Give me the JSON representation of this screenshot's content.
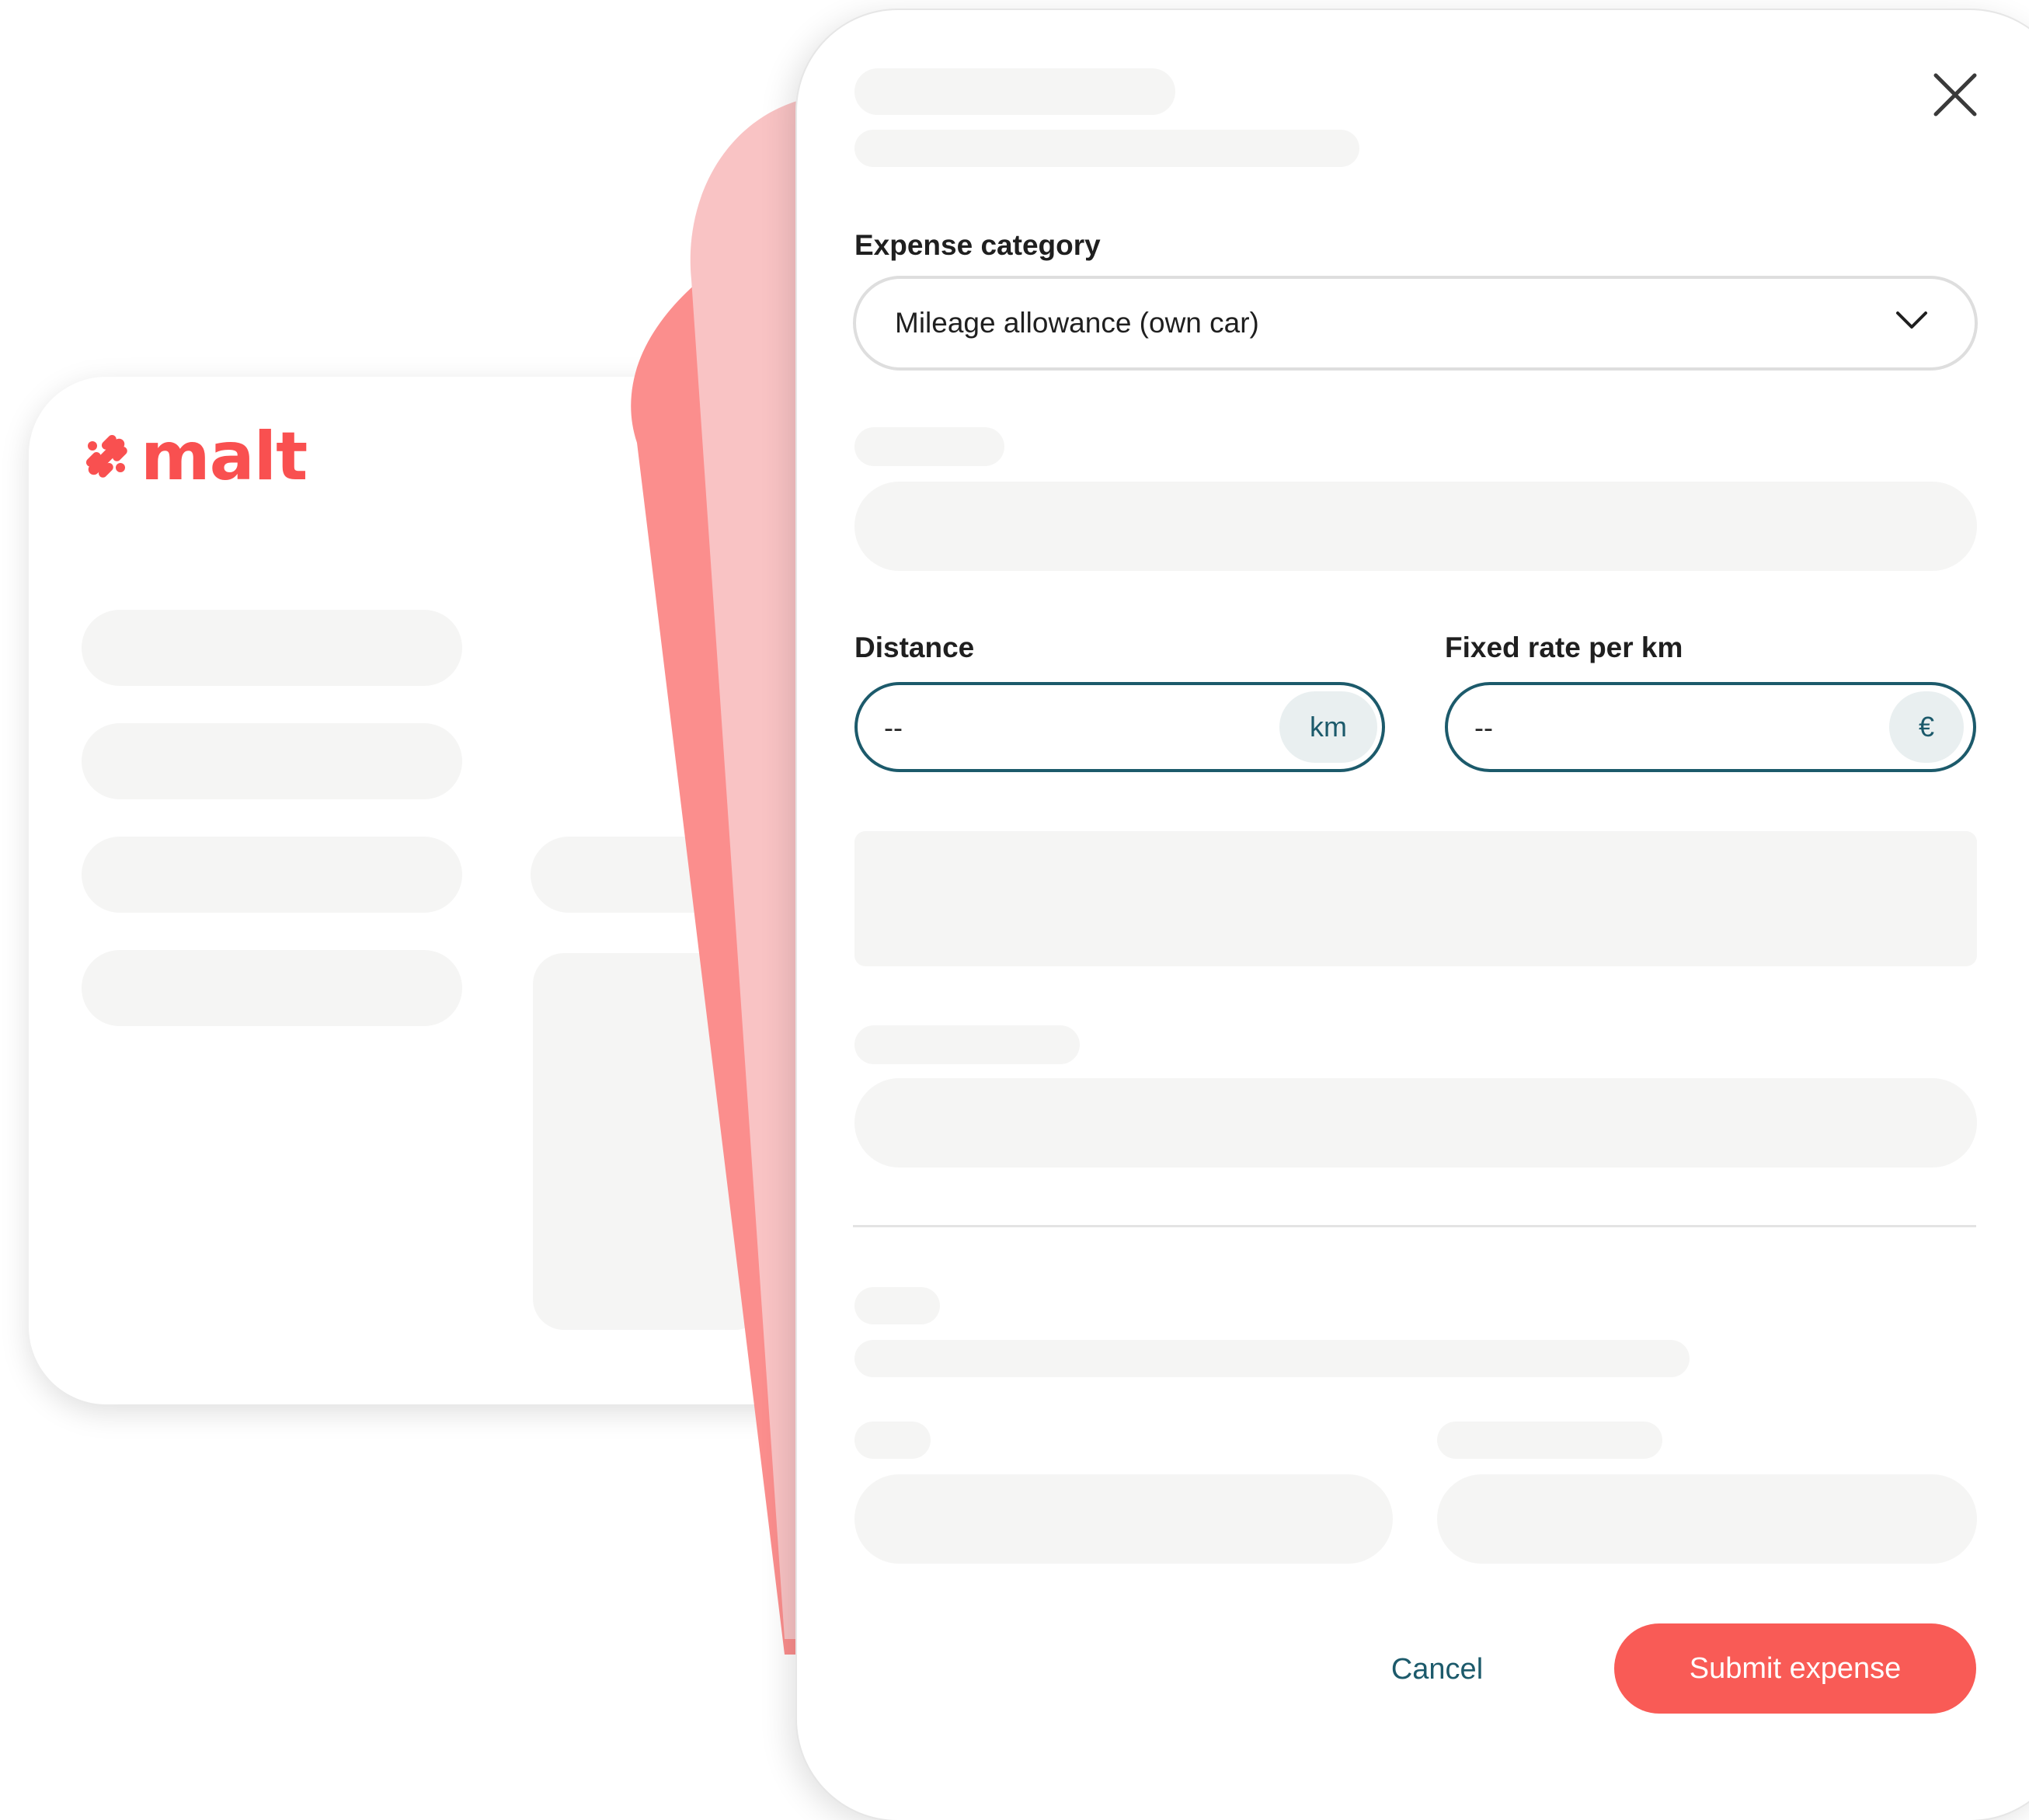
{
  "brand": {
    "name": "malt",
    "color": "#f95050"
  },
  "modal": {
    "close_icon": "close-icon",
    "expense_category": {
      "label": "Expense category",
      "value": "Mileage allowance (own car)",
      "icon": "chevron-down-icon"
    },
    "distance": {
      "label": "Distance",
      "placeholder": "--",
      "unit": "km"
    },
    "rate": {
      "label": "Fixed rate per km",
      "placeholder": "--",
      "unit": "€"
    },
    "actions": {
      "cancel": "Cancel",
      "submit": "Submit expense"
    }
  },
  "colors": {
    "accent": "#f95b56",
    "teal": "#1c5a6b",
    "skeleton": "#f5f5f4",
    "sheet_light": "#f9c3c4",
    "sheet_dark": "#fb8e8d"
  }
}
